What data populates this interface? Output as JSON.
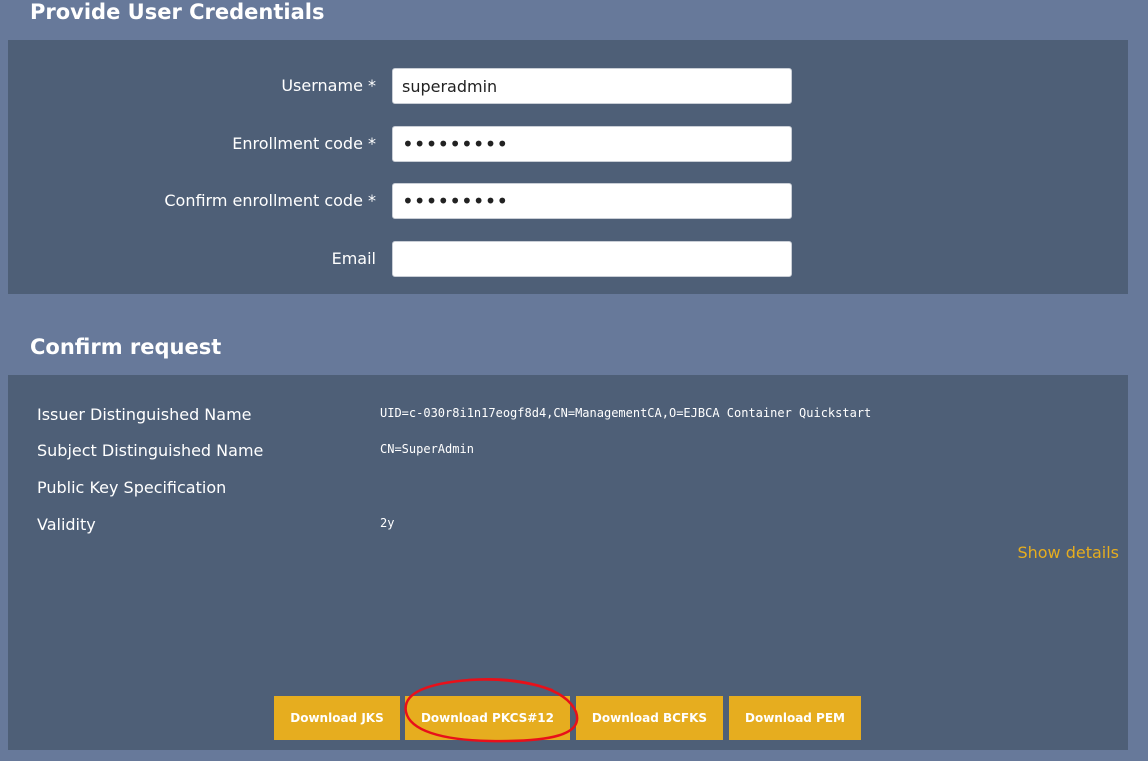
{
  "credentials": {
    "title": "Provide User Credentials",
    "fields": {
      "username": {
        "label": "Username *",
        "value": "superadmin"
      },
      "enrollment_code": {
        "label": "Enrollment code *",
        "value": "•••••••••"
      },
      "confirm_enrollment_code": {
        "label": "Confirm enrollment code *",
        "value": "•••••••••"
      },
      "email": {
        "label": "Email",
        "value": ""
      }
    }
  },
  "confirm": {
    "title": "Confirm request",
    "rows": [
      {
        "label": "Issuer Distinguished Name",
        "value": "UID=c-030r8i1n17eogf8d4,CN=ManagementCA,O=EJBCA Container Quickstart"
      },
      {
        "label": "Subject Distinguished Name",
        "value": "CN=SuperAdmin"
      },
      {
        "label": "Public Key Specification",
        "value": ""
      },
      {
        "label": "Validity",
        "value": "2y"
      }
    ],
    "show_details": "Show details",
    "buttons": {
      "jks": "Download JKS",
      "pkcs12": "Download PKCS#12",
      "bcfks": "Download BCFKS",
      "pem": "Download PEM"
    }
  },
  "colors": {
    "page_background": "#67799a",
    "panel_background": "#4e5f77",
    "accent": "#e6ad1f",
    "annotation": "#e8101a"
  }
}
